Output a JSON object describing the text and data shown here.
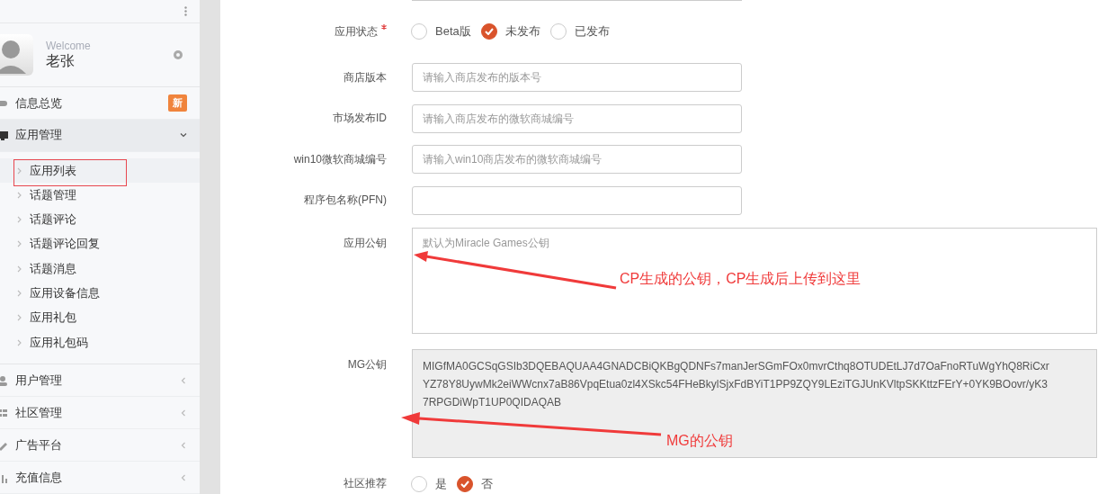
{
  "sidebar": {
    "welcome": "Welcome",
    "user_name": "老张",
    "menu": [
      {
        "label": "信息总览",
        "kind": "link",
        "badge": "新"
      },
      {
        "label": "应用管理",
        "kind": "group",
        "expanded": true,
        "children": [
          {
            "label": "应用列表",
            "selected": true
          },
          {
            "label": "话题管理",
            "selected": false
          },
          {
            "label": "话题评论",
            "selected": false
          },
          {
            "label": "话题评论回复",
            "selected": false
          },
          {
            "label": "话题消息",
            "selected": false
          },
          {
            "label": "应用设备信息",
            "selected": false
          },
          {
            "label": "应用礼包",
            "selected": false
          },
          {
            "label": "应用礼包码",
            "selected": false
          }
        ]
      },
      {
        "label": "用户管理",
        "kind": "group",
        "expanded": false
      },
      {
        "label": "社区管理",
        "kind": "group",
        "expanded": false
      },
      {
        "label": "广告平台",
        "kind": "group",
        "expanded": false
      },
      {
        "label": "充值信息",
        "kind": "group",
        "expanded": false
      }
    ]
  },
  "form": {
    "fields": [
      {
        "kind": "cut"
      },
      {
        "kind": "radio",
        "label": "应用状态",
        "required": true,
        "options": [
          {
            "label": "Beta版",
            "selected": false
          },
          {
            "label": "未发布",
            "selected": true
          },
          {
            "label": "已发布",
            "selected": false
          }
        ]
      },
      {
        "kind": "input",
        "label": "商店版本",
        "placeholder": "请输入商店发布的版本号"
      },
      {
        "kind": "input",
        "label": "市场发布ID",
        "placeholder": "请输入商店发布的微软商城编号"
      },
      {
        "kind": "input",
        "label": "win10微软商城编号",
        "placeholder": "请输入win10商店发布的微软商城编号"
      },
      {
        "kind": "input",
        "label": "程序包名称(PFN)"
      },
      {
        "kind": "textarea",
        "label": "应用公钥",
        "placeholder": "默认为Miracle Games公钥"
      },
      {
        "kind": "readonly",
        "label": "MG公钥",
        "value": "MIGfMA0GCSqGSIb3DQEBAQUAA4GNADCBiQKBgQDNFs7manJerSGmFOx0mvrCthq8OTUDEtLJ7d7OaFnoRTuWgYhQ8RiCxrYZ78Y8UywMk2eiWWcnx7aB86VpqEtua0zl4XSkc54FHeBkylSjxFdBYiT1PP9ZQY9LEziTGJUnKVltpSKKttzFErY+0YK9BOovr/yK37RPGDiWpT1UP0QIDAQAB"
      },
      {
        "kind": "radio",
        "label": "社区推荐",
        "required": false,
        "options": [
          {
            "label": "是",
            "selected": false
          },
          {
            "label": "否",
            "selected": true
          }
        ]
      }
    ]
  },
  "annotations": [
    "CP生成的公钥，CP生成后上传到这里",
    "MG的公钥"
  ]
}
